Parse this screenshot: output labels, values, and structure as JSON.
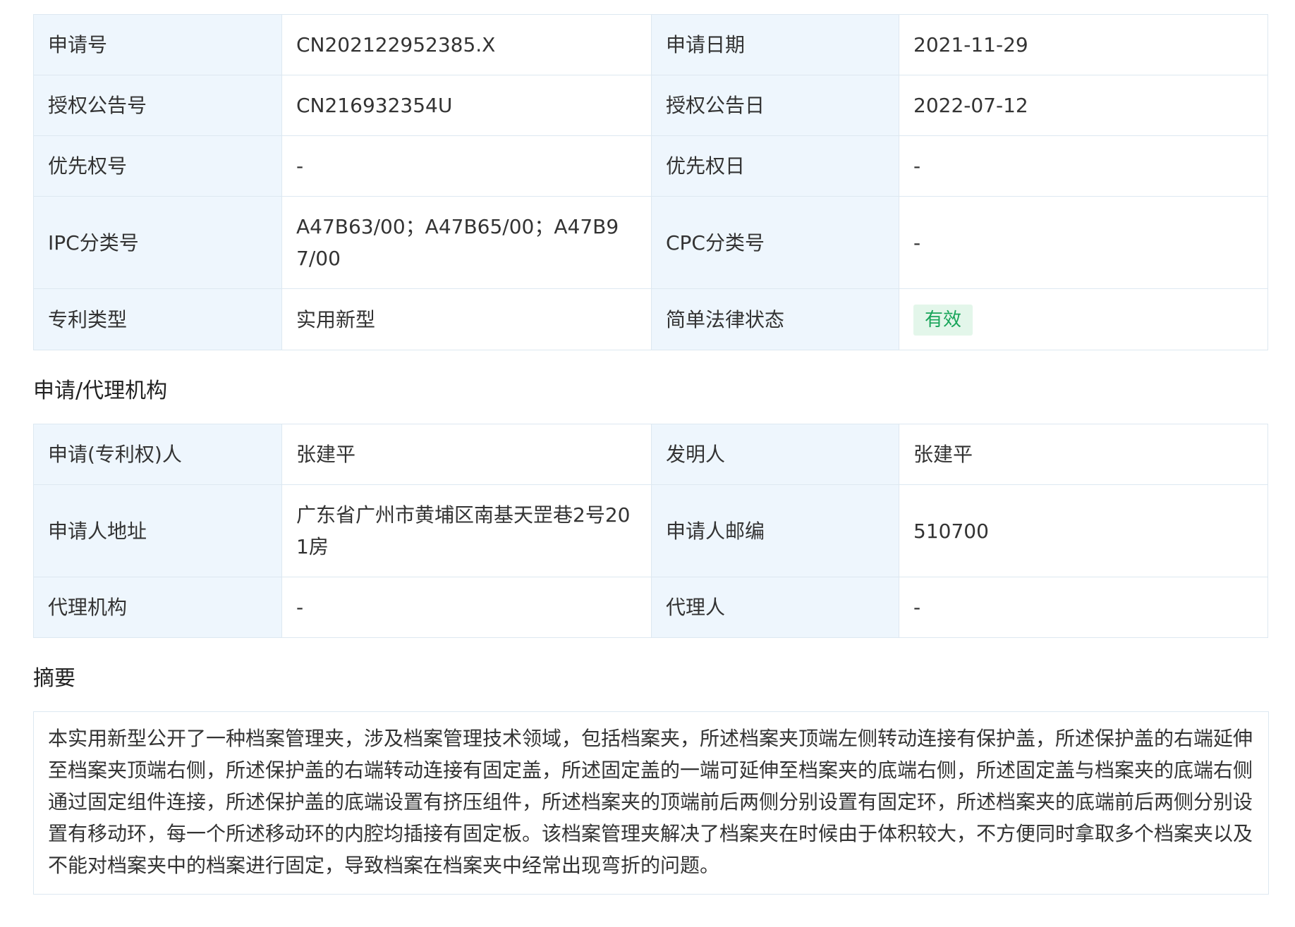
{
  "basic_info": {
    "rows": [
      {
        "l1": "申请号",
        "v1": "CN202122952385.X",
        "l2": "申请日期",
        "v2": "2021-11-29"
      },
      {
        "l1": "授权公告号",
        "v1": "CN216932354U",
        "l2": "授权公告日",
        "v2": "2022-07-12"
      },
      {
        "l1": "优先权号",
        "v1": "-",
        "l2": "优先权日",
        "v2": "-"
      },
      {
        "l1": "IPC分类号",
        "v1": "A47B63/00；A47B65/00；A47B97/00",
        "l2": "CPC分类号",
        "v2": "-"
      },
      {
        "l1": "专利类型",
        "v1": "实用新型",
        "l2": "简单法律状态",
        "v2": "有效"
      }
    ],
    "status_color": "#19a55a"
  },
  "agency": {
    "title": "申请/代理机构",
    "rows": [
      {
        "l1": "申请(专利权)人",
        "v1": "张建平",
        "l2": "发明人",
        "v2": "张建平"
      },
      {
        "l1": "申请人地址",
        "v1": "广东省广州市黄埔区南基天罡巷2号201房",
        "l2": "申请人邮编",
        "v2": "510700"
      },
      {
        "l1": "代理机构",
        "v1": "-",
        "l2": "代理人",
        "v2": "-"
      }
    ]
  },
  "abstract": {
    "title": "摘要",
    "text": "本实用新型公开了一种档案管理夹，涉及档案管理技术领域，包括档案夹，所述档案夹顶端左侧转动连接有保护盖，所述保护盖的右端延伸至档案夹顶端右侧，所述保护盖的右端转动连接有固定盖，所述固定盖的一端可延伸至档案夹的底端右侧，所述固定盖与档案夹的底端右侧通过固定组件连接，所述保护盖的底端设置有挤压组件，所述档案夹的顶端前后两侧分别设置有固定环，所述档案夹的底端前后两侧分别设置有移动环，每一个所述移动环的内腔均插接有固定板。该档案管理夹解决了档案夹在时候由于体积较大，不方便同时拿取多个档案夹以及不能对档案夹中的档案进行固定，导致档案在档案夹中经常出现弯折的问题。"
  }
}
